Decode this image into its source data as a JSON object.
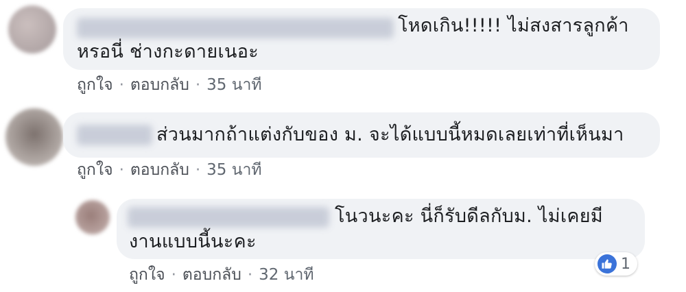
{
  "comments": [
    {
      "text_line1": "โหดเกิน!!!!! ไม่สงสารลูกค้า",
      "text_line2": "หรอนี่ ช่างกะดายเนอะ",
      "like": "ถูกใจ",
      "reply": "ตอบกลับ",
      "separator": "·",
      "time": "35 นาที"
    },
    {
      "text_line1": "ส่วนมากถ้าแต่งกับของ ม. จะได้แบบนี้หมดเลยเท่าที่เห็นมา",
      "like": "ถูกใจ",
      "reply": "ตอบกลับ",
      "separator": "·",
      "time": "35 นาที"
    },
    {
      "text_line1": "โนวนะคะ นี่ก็รับดีลกับม. ไม่เคยมี",
      "text_line2": "งานแบบนี้นะคะ",
      "like": "ถูกใจ",
      "reply": "ตอบกลับ",
      "separator": "·",
      "time": "32 นาที",
      "reaction_icon": "like-thumb-icon",
      "reaction_count": "1"
    }
  ],
  "colors": {
    "bubble_bg": "#f0f2f5",
    "action_text": "#4b4f56",
    "like_blue": "#3b73d9"
  }
}
